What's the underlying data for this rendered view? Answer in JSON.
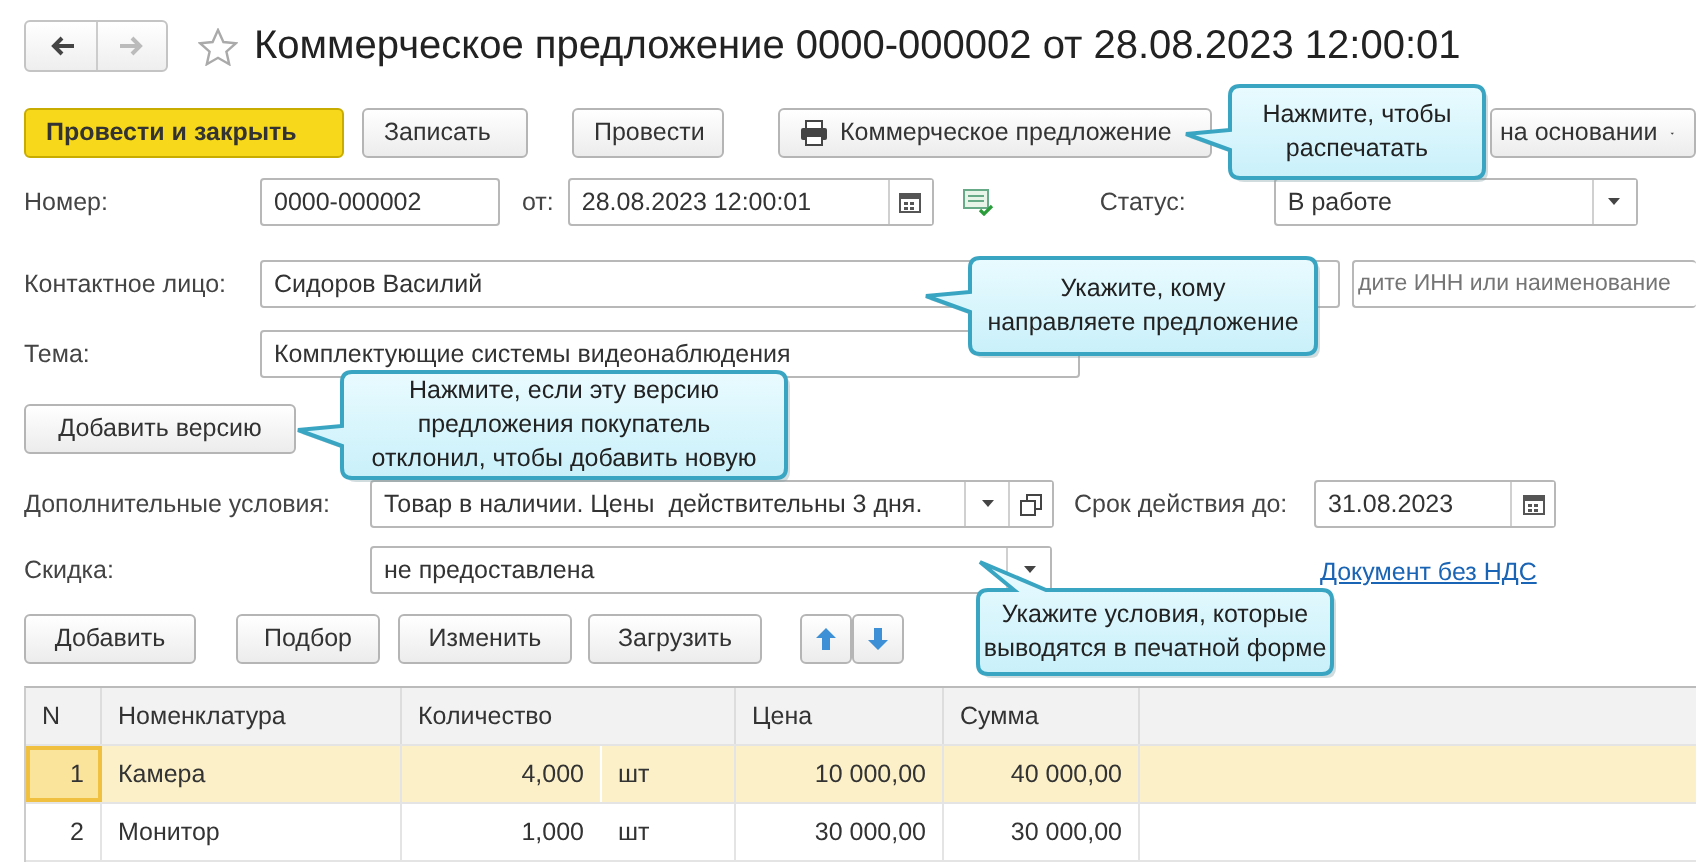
{
  "nav": {
    "back_enabled": true,
    "forward_enabled": false
  },
  "favorite": false,
  "title": "Коммерческое предложение 0000-000002 от 28.08.2023 12:00:01",
  "toolbar": [
    {
      "label": "Провести и закрыть",
      "kind": "primary"
    },
    {
      "label": "Записать",
      "kind": "plain"
    },
    {
      "label": "Провести",
      "kind": "plain"
    },
    {
      "label": "Коммерческое предложение",
      "kind": "print"
    },
    {
      "label": "на основании",
      "kind": "menu"
    }
  ],
  "number": {
    "label": "Номер:",
    "value": "0000-000002"
  },
  "date": {
    "label": "от:",
    "value": "28.08.2023 12:00:01"
  },
  "status": {
    "label": "Статус:",
    "value": "В работе"
  },
  "contact": {
    "label": "Контактное лицо:",
    "value": "Сидоров Василий"
  },
  "counterparty_search": {
    "placeholder": "дите ИНН или наименование"
  },
  "theme": {
    "label": "Тема:",
    "value": "Комплектующие системы видеонаблюдения"
  },
  "add_version_button": "Добавить версию",
  "conditions": {
    "label": "Дополнительные условия:",
    "value": "Товар в наличии. Цены  действительны 3 дня."
  },
  "valid_until": {
    "label": "Срок действия до:",
    "value": "31.08.2023"
  },
  "discount": {
    "label": "Скидка:",
    "value": "не предоставлена"
  },
  "no_vat_link": "Документ без НДС",
  "table_buttons": [
    "Добавить",
    "Подбор",
    "Изменить",
    "Загрузить"
  ],
  "table": {
    "columns": [
      "N",
      "Номенклатура",
      "Количество",
      "Цена",
      "Сумма"
    ],
    "rows": [
      {
        "n": "1",
        "item": "Камера",
        "quantity": "4,000",
        "unit": "шт",
        "price": "10 000,00",
        "sum": "40 000,00",
        "selected": true
      },
      {
        "n": "2",
        "item": "Монитор",
        "quantity": "1,000",
        "unit": "шт",
        "price": "30 000,00",
        "sum": "30 000,00",
        "selected": false
      }
    ]
  },
  "hints": [
    {
      "lines": [
        "Нажмите, чтобы",
        "распечатать"
      ]
    },
    {
      "lines": [
        "Укажите, кому",
        "направляете предложение"
      ]
    },
    {
      "lines": [
        "Нажмите, если эту версию",
        "предложения покупатель",
        "отклонил, чтобы добавить новую"
      ]
    },
    {
      "lines": [
        "Укажите условия, которые",
        "выводятся в печатной форме"
      ]
    }
  ]
}
